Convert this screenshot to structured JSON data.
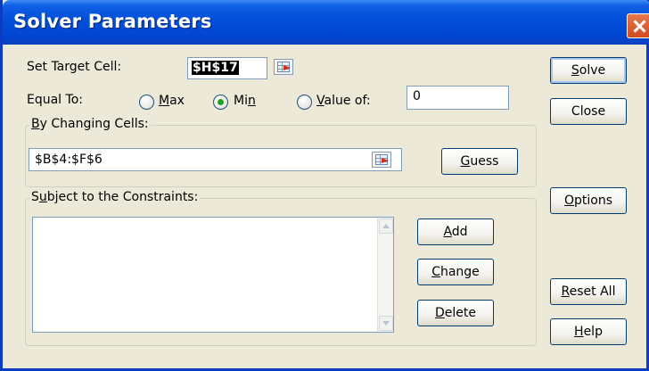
{
  "window": {
    "title": "Solver Parameters",
    "close_icon": "close-x-icon"
  },
  "target": {
    "label_prefix": "Set Target Cell:",
    "value": "$H$17",
    "ref_icon": "range-select-icon"
  },
  "equal_to": {
    "label": "Equal To:",
    "options": [
      {
        "prefix": "",
        "accel": "M",
        "rest": "ax",
        "selected": false
      },
      {
        "prefix": "Mi",
        "accel": "n",
        "rest": "",
        "selected": true
      },
      {
        "prefix": "",
        "accel": "V",
        "rest": "alue of:",
        "selected": false
      }
    ],
    "value_of": "0"
  },
  "changing_cells": {
    "title_accel": "B",
    "title_rest": "y Changing Cells:",
    "value": "$B$4:$F$6",
    "ref_icon": "range-select-icon",
    "guess": {
      "accel": "G",
      "rest": "uess"
    }
  },
  "constraints": {
    "title_prefix": "S",
    "title_accel": "u",
    "title_rest": "bject to the Constraints:",
    "items": [],
    "add": {
      "accel": "A",
      "rest": "dd"
    },
    "change": {
      "accel": "C",
      "rest": "hange"
    },
    "delete": {
      "accel": "D",
      "rest": "elete"
    }
  },
  "side_buttons": {
    "solve": {
      "accel": "S",
      "rest": "olve"
    },
    "close": {
      "label": "Close"
    },
    "options": {
      "accel": "O",
      "rest": "ptions"
    },
    "reset": {
      "accel": "R",
      "rest": "eset All"
    },
    "help": {
      "accel": "H",
      "rest": "elp"
    }
  },
  "colors": {
    "title_bar": "#0046d2",
    "dialog_bg": "#ece9d8",
    "radio_dot": "#21a121",
    "button_border": "#003c74"
  }
}
